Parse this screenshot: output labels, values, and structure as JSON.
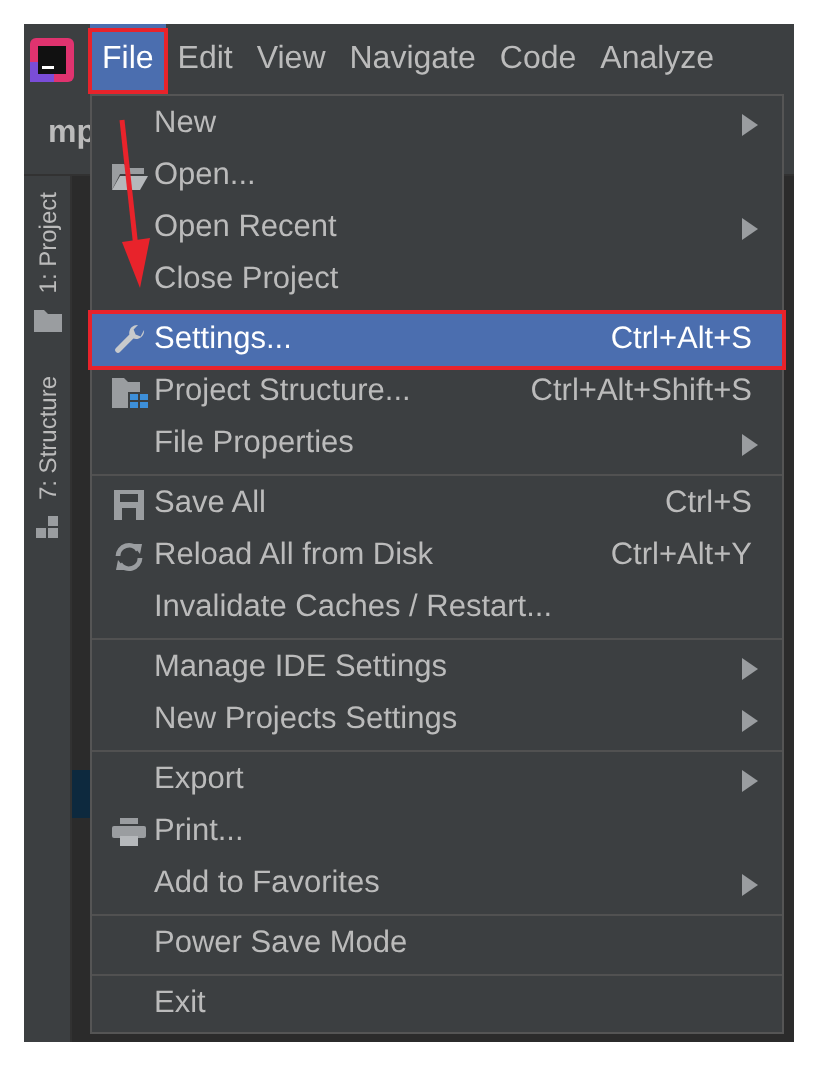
{
  "menu_bar": [
    {
      "label": "File",
      "selected": true,
      "annotated": true
    },
    {
      "label": "Edit",
      "selected": false,
      "annotated": false
    },
    {
      "label": "View",
      "selected": false,
      "annotated": false
    },
    {
      "label": "Navigate",
      "selected": false,
      "annotated": false
    },
    {
      "label": "Code",
      "selected": false,
      "annotated": false
    },
    {
      "label": "Analyze",
      "selected": false,
      "annotated": false
    }
  ],
  "project_title": "mp",
  "tool_windows": [
    {
      "label": "1: Project"
    },
    {
      "label": "7: Structure"
    }
  ],
  "file_menu": [
    {
      "kind": "item",
      "label": "New",
      "submenu": true,
      "selected": false,
      "annotated": false
    },
    {
      "kind": "item",
      "label": "Open...",
      "submenu": false,
      "selected": false,
      "annotated": false
    },
    {
      "kind": "item",
      "label": "Open Recent",
      "submenu": true,
      "selected": false,
      "annotated": false
    },
    {
      "kind": "item",
      "label": "Close Project",
      "submenu": false,
      "selected": false,
      "annotated": false
    },
    {
      "kind": "separator"
    },
    {
      "kind": "item",
      "label": "Settings...",
      "shortcut": "Ctrl+Alt+S",
      "submenu": false,
      "selected": true,
      "annotated": true
    },
    {
      "kind": "item",
      "label": "Project Structure...",
      "shortcut": "Ctrl+Alt+Shift+S",
      "submenu": false,
      "selected": false,
      "annotated": false
    },
    {
      "kind": "item",
      "label": "File Properties",
      "submenu": true,
      "selected": false,
      "annotated": false
    },
    {
      "kind": "separator"
    },
    {
      "kind": "item",
      "label": "Save All",
      "shortcut": "Ctrl+S",
      "submenu": false,
      "selected": false,
      "annotated": false
    },
    {
      "kind": "item",
      "label": "Reload All from Disk",
      "shortcut": "Ctrl+Alt+Y",
      "submenu": false,
      "selected": false,
      "annotated": false
    },
    {
      "kind": "item",
      "label": "Invalidate Caches / Restart...",
      "submenu": false,
      "selected": false,
      "annotated": false
    },
    {
      "kind": "separator"
    },
    {
      "kind": "item",
      "label": "Manage IDE Settings",
      "submenu": true,
      "selected": false,
      "annotated": false
    },
    {
      "kind": "item",
      "label": "New Projects Settings",
      "submenu": true,
      "selected": false,
      "annotated": false
    },
    {
      "kind": "separator"
    },
    {
      "kind": "item",
      "label": "Export",
      "submenu": true,
      "selected": false,
      "annotated": false
    },
    {
      "kind": "item",
      "label": "Print...",
      "submenu": false,
      "selected": false,
      "annotated": false
    },
    {
      "kind": "item",
      "label": "Add to Favorites",
      "submenu": true,
      "selected": false,
      "annotated": false
    },
    {
      "kind": "separator"
    },
    {
      "kind": "item",
      "label": "Power Save Mode",
      "submenu": false,
      "selected": false,
      "annotated": false
    },
    {
      "kind": "separator"
    },
    {
      "kind": "item",
      "label": "Exit",
      "submenu": false,
      "selected": false,
      "annotated": false
    }
  ]
}
